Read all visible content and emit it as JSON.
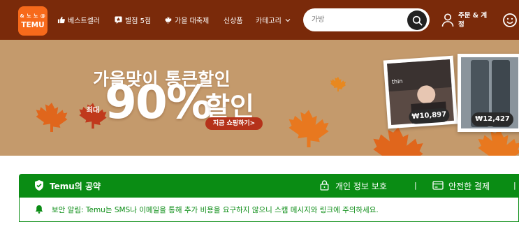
{
  "brand": {
    "logo_top": "& 노 노 @",
    "logo_text": "TEMU",
    "brand_color": "#f76a1b",
    "header_color": "#7a2a0a"
  },
  "nav": {
    "best": "베스트셀러",
    "five_star": "별점 5점",
    "fall_festival": "가을 대축제",
    "new": "신상품",
    "category": "카테고리"
  },
  "search": {
    "placeholder": "가방"
  },
  "account": {
    "label": "주문 & 계정"
  },
  "banner": {
    "headline": "가을맞이 통큰할인",
    "max_label": "최대",
    "percent": "90%",
    "sale_word": "할인",
    "shop_now": "지금 쇼핑하기>",
    "photo1_tag": "thin",
    "price1": "₩10,897",
    "price2": "₩12,427",
    "bg_color": "#c49a6c"
  },
  "promise": {
    "title": "Temu의 공약",
    "privacy": "개인 정보 보호",
    "separator": "|",
    "secure_payment": "안전한 결제",
    "color": "#0a8c14"
  },
  "alert": {
    "text": "보안 알림: Temu는 SMS나 이메일을 통해 추가 비용을 요구하지 않으니 스캠 메시지와 링크에 주의하세요."
  }
}
